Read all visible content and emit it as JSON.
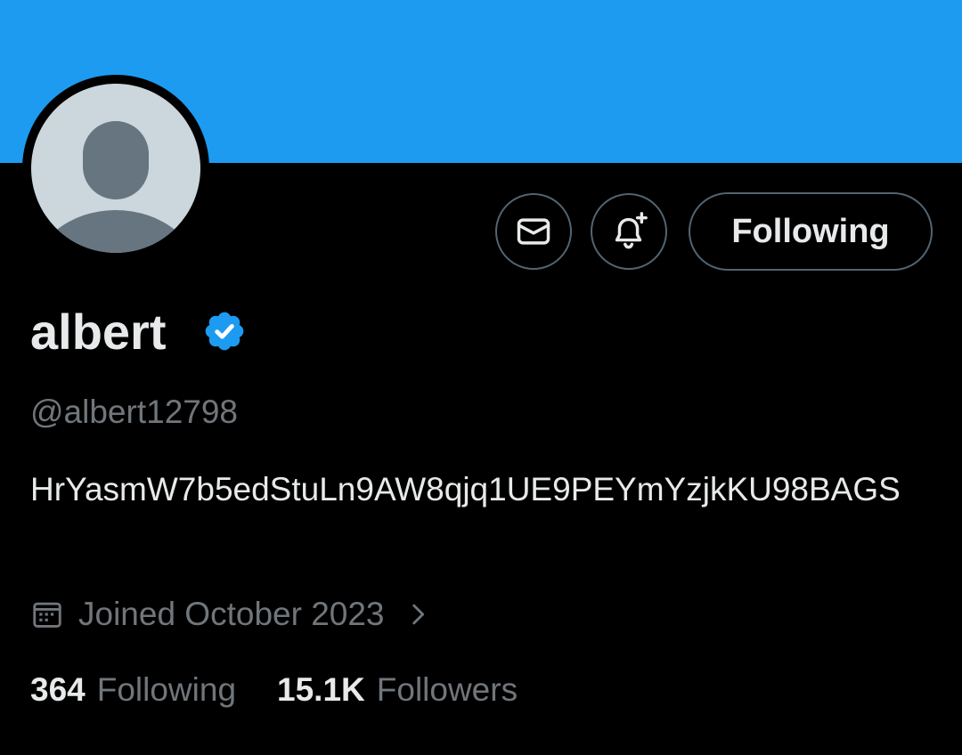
{
  "profile": {
    "display_name": "albert",
    "handle": "@albert12798",
    "bio": "HrYasmW7b5edStuLn9AW8qjq1UE9PEYmYzjkKU98BAGS",
    "joined": "Joined October 2023",
    "verified": true
  },
  "actions": {
    "message_icon": "envelope-icon",
    "notify_icon": "bell-plus-icon",
    "follow_label": "Following"
  },
  "stats": {
    "following_count": "364",
    "following_label": "Following",
    "followers_count": "15.1K",
    "followers_label": "Followers"
  },
  "colors": {
    "banner": "#1d9bf0",
    "background": "#000000",
    "primary_text": "#e7e9ea",
    "secondary_text": "#71767b",
    "button_border": "#536471",
    "verified_badge": "#1d9bf0",
    "avatar_background": "#ccd6dd",
    "avatar_silhouette": "#66757f"
  }
}
